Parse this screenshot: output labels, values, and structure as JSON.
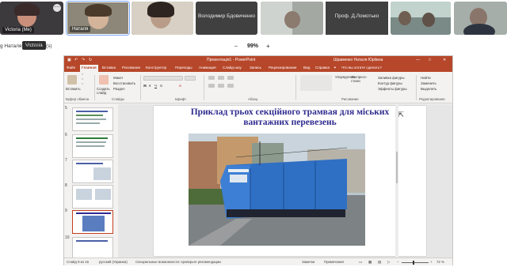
{
  "meeting": {
    "participants": [
      {
        "label": "Victoria (Me)",
        "bg": "#3d3a3e"
      },
      {
        "label": "Наталя",
        "bg": "#6b655c"
      },
      {
        "label": "",
        "bg": "#504a44"
      },
      {
        "label": "",
        "bg": "#6a5a4c"
      },
      {
        "label": "Володимир Бдовиченко",
        "bg": "#404040"
      },
      {
        "label": "",
        "bg": "#a4a8a2"
      },
      {
        "label": "Проф. Д.Ломотько",
        "bg": "#404040"
      },
      {
        "label": "",
        "bg": "#7a8a86"
      },
      {
        "label": "",
        "bg": "#a5aea9"
      }
    ],
    "more_glyph": "⋯",
    "tooltip": "Victoria",
    "participants_line": "g Наталя, Victoria  n(s)",
    "zoom_percent": "99%",
    "zoom_minus": "–",
    "zoom_plus": "+"
  },
  "ppt": {
    "window_title": "Презентація1 - PowerPoint",
    "user_name": "Шраменко Наталя Юріївна",
    "window_controls": [
      "—",
      "□",
      "✕"
    ],
    "tabs": [
      "Файл",
      "Главная",
      "Вставка",
      "Рисование",
      "Конструктор",
      "Переходы",
      "Анимация",
      "Слайд-шоу",
      "Запись",
      "Рецензирование",
      "Вид",
      "Справка"
    ],
    "active_tab": "Главная",
    "tell_me": "Что вы хотите сделать?",
    "ribbon_groups": [
      "Буфер обмена",
      "Слайды",
      "Шрифт",
      "Абзац",
      "Рисование",
      "Редактирование"
    ],
    "ribbon_items": {
      "paste": "Вставить",
      "create_slide": "Создать слайд",
      "layout": "Макет",
      "reset": "Восстановить",
      "section": "Раздел",
      "arrange": "Упорядочить",
      "express_styles": "Экспресс-стили",
      "fill": "Заливка фигуры",
      "outline": "Контур фигуры",
      "effects": "Эффекты фигуры",
      "find": "Найти",
      "replace": "Заменить",
      "select": "Выделить"
    },
    "thumbnail_numbers": [
      "5",
      "6",
      "7",
      "8",
      "9",
      "10"
    ],
    "selected_slide": "9",
    "slide": {
      "title": "Приклад трьох секційного трамвая для міських вантажних перевезень"
    },
    "status": {
      "slide_info": "Слайд 9 из 16",
      "language": "русский (Украина)",
      "accessibility": "Специальные возможности: проверьте рекомендации",
      "notes": "Заметки",
      "comments": "Примечания",
      "zoom": "72 %"
    }
  }
}
